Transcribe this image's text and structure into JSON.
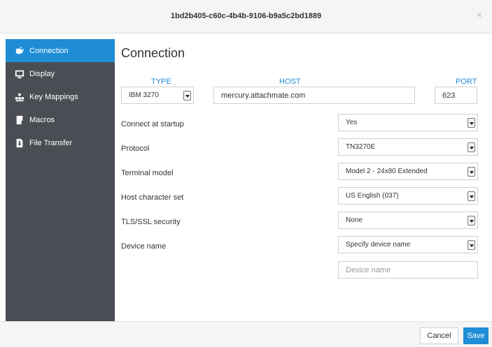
{
  "window": {
    "title": "1bd2b405-c60c-4b4b-9106-b9a5c2bd1889",
    "close_glyph": "×"
  },
  "sidebar": {
    "items": [
      {
        "label": "Connection",
        "icon": "plug-icon",
        "active": true
      },
      {
        "label": "Display",
        "icon": "monitor-icon"
      },
      {
        "label": "Key Mappings",
        "icon": "keyboard-icon"
      },
      {
        "label": "Macros",
        "icon": "script-icon"
      },
      {
        "label": "File Transfer",
        "icon": "file-transfer-icon"
      }
    ]
  },
  "main": {
    "heading": "Connection",
    "type": {
      "label": "TYPE",
      "value": "IBM 3270"
    },
    "host": {
      "label": "HOST",
      "value": "mercury.attachmate.com"
    },
    "port": {
      "label": "PORT",
      "value": "623"
    },
    "fields": [
      {
        "label": "Connect at startup",
        "value": "Yes"
      },
      {
        "label": "Protocol",
        "value": "TN3270E"
      },
      {
        "label": "Terminal model",
        "value": "Model 2 - 24x80 Extended"
      },
      {
        "label": "Host character set",
        "value": "US English (037)"
      },
      {
        "label": "TLS/SSL security",
        "value": "None"
      },
      {
        "label": "Device name",
        "value": "Specify device name"
      }
    ],
    "device_name_placeholder": "Device name"
  },
  "footer": {
    "cancel_label": "Cancel",
    "save_label": "Save"
  },
  "colors": {
    "accent": "#1f8dd6",
    "sidebar_bg": "#4a4e54"
  }
}
